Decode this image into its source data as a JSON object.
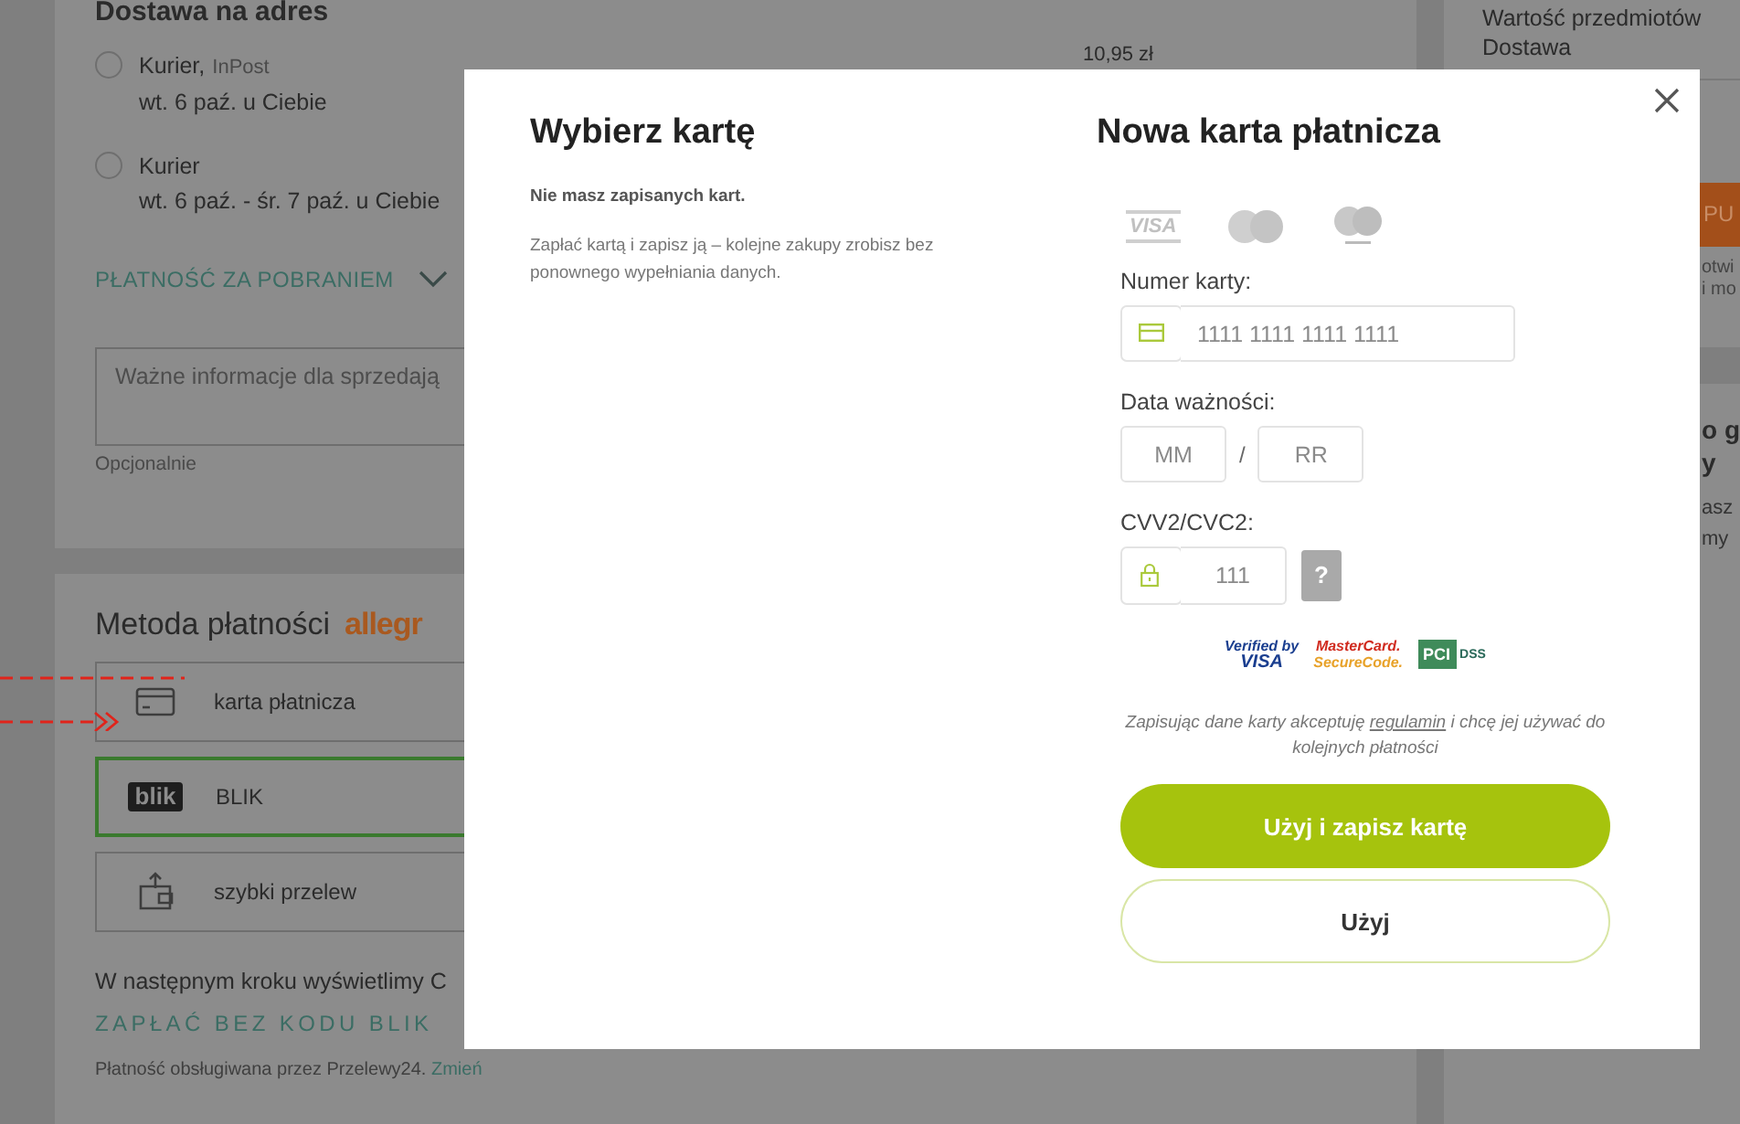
{
  "background": {
    "delivery": {
      "title": "Dostawa na adres",
      "options": [
        {
          "name": "Kurier,",
          "carrier": "InPost",
          "date": "wt. 6 paź. u Ciebie",
          "price": "10,95 zł",
          "selected": false
        },
        {
          "name": "Kurier",
          "date": "wt. 6 paź. - śr. 7 paź. u Ciebie",
          "selected": false
        }
      ],
      "cod_link": "PŁATNOŚĆ ZA POBRANIEM",
      "note": {
        "placeholder": "Ważne informacje dla sprzedają",
        "hint": "Opcjonalnie"
      }
    },
    "payment": {
      "title": "Metoda płatności",
      "brand": "allegr",
      "methods": [
        {
          "kind": "card",
          "label": "karta płatnicza",
          "selected": false
        },
        {
          "kind": "blik",
          "logo": "blik",
          "label": "BLIK",
          "selected": true
        },
        {
          "kind": "transfer",
          "label": "szybki przelew",
          "selected": false
        }
      ],
      "info": "W następnym kroku wyświetlimy C",
      "blik_link": "ZAPŁAĆ BEZ KODU BLIK",
      "provider": "Płatność obsługiwana przez Przelewy24.",
      "provider_link": "Zmień"
    },
    "summary": {
      "lines": [
        "Wartość przedmiotów",
        "Dostawa"
      ],
      "buy_button": "PU",
      "buy_note": [
        "otwi",
        "i mo"
      ],
      "promo_title": [
        "o g",
        "y"
      ],
      "promo_text": [
        "asz",
        "my"
      ]
    }
  },
  "modal": {
    "saved": {
      "title": "Wybierz kartę",
      "empty": "Nie masz zapisanych kart.",
      "text": "Zapłać kartą i zapisz ją – kolejne zakupy zrobisz bez ponownego wypełniania danych."
    },
    "new_card": {
      "title": "Nowa karta płatnicza",
      "card_brands": [
        {
          "kind": "visa",
          "text": "VISA"
        },
        {
          "kind": "mastercard"
        },
        {
          "kind": "maestro"
        }
      ],
      "number": {
        "label": "Numer karty:",
        "placeholder": "1111 1111 1111 1111"
      },
      "expiry": {
        "label": "Data ważności:",
        "month_placeholder": "MM",
        "separator": "/",
        "year_placeholder": "RR"
      },
      "cvv": {
        "label": "CVV2/CVC2:",
        "placeholder": "111",
        "help": "?"
      },
      "security_badges": [
        {
          "kind": "verified_visa",
          "lines": [
            "Verified by",
            "VISA"
          ]
        },
        {
          "kind": "mastercard_securecode",
          "lines": [
            "MasterCard.",
            "SecureCode."
          ]
        },
        {
          "kind": "pci",
          "lines": [
            "PCI",
            "DSS"
          ]
        }
      ],
      "consent": {
        "before": "Zapisując dane karty akceptuję",
        "link": "regulamin",
        "after": "i chcę jej używać do kolejnych płatności"
      },
      "buttons": [
        {
          "kind": "primary",
          "label": "Użyj i zapisz kartę"
        },
        {
          "kind": "secondary",
          "label": "Użyj"
        }
      ]
    }
  }
}
